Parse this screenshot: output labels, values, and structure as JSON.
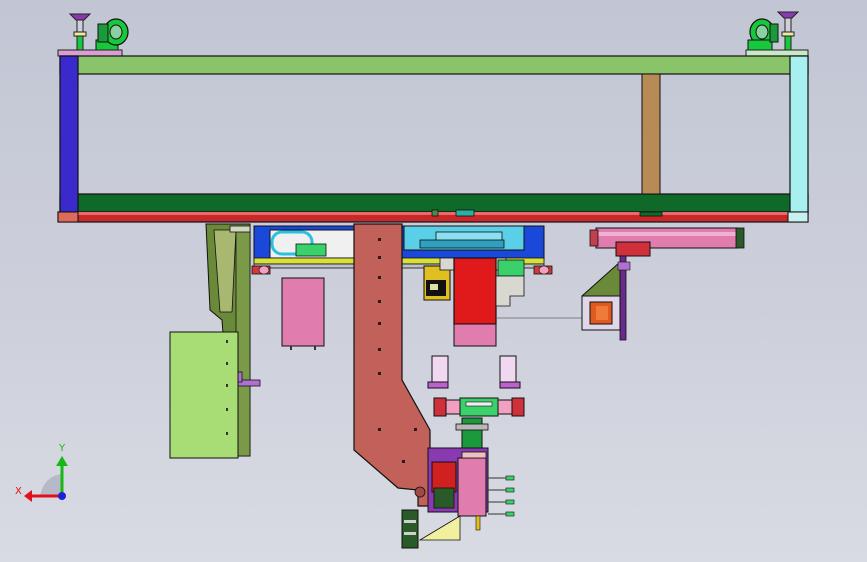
{
  "triad": {
    "x_label": "X",
    "y_label": "Y",
    "x_color": "#e0101c",
    "y_color": "#16b816",
    "z_color": "#1a22d8"
  },
  "colors": {
    "frame_green": "#8ac46a",
    "frame_dark_green": "#0f6a2a",
    "frame_left_post": "#3a2acc",
    "frame_right_post": "#a8f0f0",
    "frame_mid_post": "#b88a55",
    "base_bar": "#c9282a",
    "caster_green": "#18c83c",
    "leveling_foot": "#7a3aa0",
    "column_red": "#c2605a",
    "motor_red": "#e01a1a",
    "pink_block": "#e07cae",
    "cabinet": "#a8dc74",
    "support_olive": "#6a8a3a",
    "rail_blue": "#1a48d8",
    "cyan": "#5ad0e8"
  }
}
